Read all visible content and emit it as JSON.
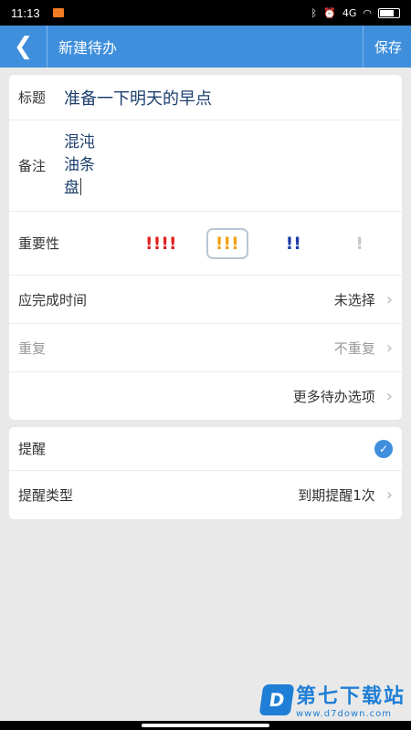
{
  "status": {
    "time": "11:13",
    "signal": "4G",
    "wifi": "wifi"
  },
  "appbar": {
    "back": "❮",
    "title": "新建待办",
    "save": "保存"
  },
  "form": {
    "title_label": "标题",
    "title_value": "准备一下明天的早点",
    "note_label": "备注",
    "note_lines": [
      "混沌",
      "油条",
      "盘"
    ],
    "importance_label": "重要性",
    "importance_options": [
      {
        "text": "!!!!",
        "color": "#e02020"
      },
      {
        "text": "!!!",
        "color": "#f2a112"
      },
      {
        "text": "!!",
        "color": "#1e3da8"
      },
      {
        "text": "!",
        "color": "#c8c8c8"
      }
    ],
    "importance_selected": 1,
    "deadline_label": "应完成时间",
    "deadline_value": "未选择",
    "repeat_label": "重复",
    "repeat_value": "不重复",
    "more_options": "更多待办选项"
  },
  "reminder": {
    "label": "提醒",
    "enabled": true,
    "type_label": "提醒类型",
    "type_value": "到期提醒1次"
  },
  "watermark": {
    "logo": "D",
    "title": "第七下载站",
    "url": "www.d7down.com"
  }
}
